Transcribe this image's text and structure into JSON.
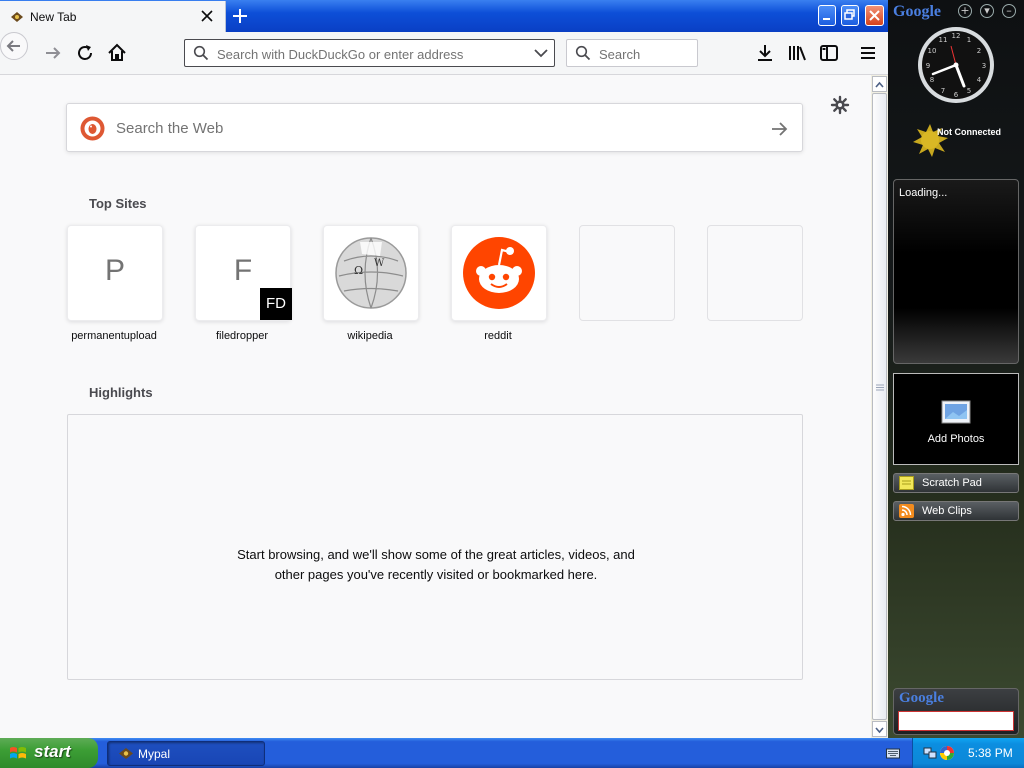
{
  "browser": {
    "tab": {
      "title": "New Tab"
    },
    "urlbar": {
      "placeholder": "Search with DuckDuckGo or enter address"
    },
    "searchbar": {
      "placeholder": "Search"
    }
  },
  "newtab": {
    "web_search": {
      "placeholder": "Search the Web"
    },
    "top_sites": {
      "title": "Top Sites",
      "sites": [
        {
          "label": "permanentupload",
          "letter": "P"
        },
        {
          "label": "filedropper",
          "letter": "F",
          "badge": "FD"
        },
        {
          "label": "wikipedia"
        },
        {
          "label": "reddit"
        }
      ]
    },
    "highlights": {
      "title": "Highlights",
      "message": "Start browsing, and we'll show some of the great articles, videos, and other pages you've recently visited or bookmarked here."
    }
  },
  "sidebar": {
    "logo": "Google",
    "status": "Not Connected",
    "news_text": "Loading...",
    "photos_label": "Add Photos",
    "gadgets": [
      "Scratch Pad",
      "Web Clips"
    ],
    "search_logo": "Google"
  },
  "taskbar": {
    "start_label": "start",
    "task_label": "Mypal",
    "clock": "5:38 PM"
  },
  "colors": {
    "xp_blue": "#245edb",
    "start_green": "#3c9e35",
    "reddit_orange": "#ff4500",
    "ddg_orange": "#de5833"
  }
}
